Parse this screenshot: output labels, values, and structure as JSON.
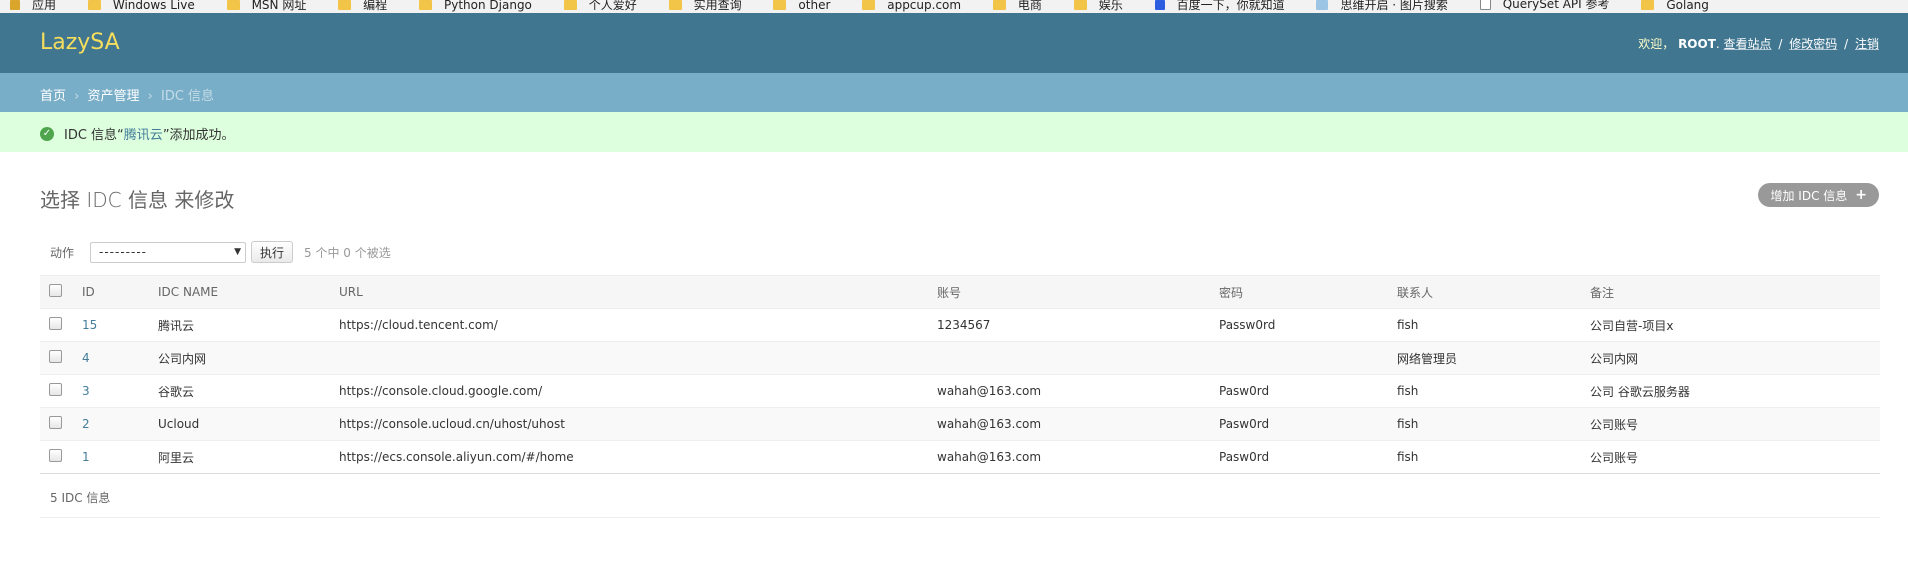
{
  "bookmarks": [
    {
      "label": "应用",
      "icon": "apps-icon"
    },
    {
      "label": "Windows Live",
      "icon": "folder-icon"
    },
    {
      "label": "MSN 网址",
      "icon": "folder-icon"
    },
    {
      "label": "编程",
      "icon": "folder-icon"
    },
    {
      "label": "Python Django",
      "icon": "folder-icon"
    },
    {
      "label": "个人爱好",
      "icon": "folder-icon"
    },
    {
      "label": "实用查询",
      "icon": "folder-icon"
    },
    {
      "label": "other",
      "icon": "folder-icon"
    },
    {
      "label": "appcup.com",
      "icon": "folder-icon"
    },
    {
      "label": "电商",
      "icon": "folder-icon"
    },
    {
      "label": "娱乐",
      "icon": "folder-icon"
    },
    {
      "label": "百度一下，你就知道",
      "icon": "baidu-icon"
    },
    {
      "label": "思维开启 · 图片搜索",
      "icon": "cloud-icon"
    },
    {
      "label": "QuerySet API 参考",
      "icon": "page-icon"
    },
    {
      "label": "Golang",
      "icon": "folder-icon"
    }
  ],
  "header": {
    "brand": "LazySA",
    "welcome": "欢迎，",
    "username": "ROOT",
    "period": ".",
    "view_site": "查看站点",
    "change_password": "修改密码",
    "logout": "注销",
    "separator": "/"
  },
  "breadcrumbs": {
    "home": "首页",
    "app": "资产管理",
    "current": "IDC 信息",
    "arrow": "›"
  },
  "message": {
    "prefix": "IDC 信息“",
    "object": "腾讯云",
    "suffix": "”添加成功。",
    "icon": "success-check-icon"
  },
  "page": {
    "title": "选择 IDC 信息 来修改",
    "add_button": "增加 IDC 信息",
    "add_icon": "+"
  },
  "actions": {
    "label": "动作",
    "selected": "---------",
    "go": "执行",
    "counter": "5 个中 0 个被选"
  },
  "table": {
    "columns": [
      "ID",
      "IDC NAME",
      "URL",
      "账号",
      "密码",
      "联系人",
      "备注"
    ],
    "rows": [
      {
        "id": "15",
        "name": "腾讯云",
        "url": "https://cloud.tencent.com/",
        "account": "1234567",
        "password": "Passw0rd",
        "contact": "fish",
        "note": "公司自营-项目x"
      },
      {
        "id": "4",
        "name": "公司内网",
        "url": "",
        "account": "",
        "password": "",
        "contact": "网络管理员",
        "note": "公司内网"
      },
      {
        "id": "3",
        "name": "谷歌云",
        "url": "https://console.cloud.google.com/",
        "account": "wahah@163.com",
        "password": "Pasw0rd",
        "contact": "fish",
        "note": "公司 谷歌云服务器"
      },
      {
        "id": "2",
        "name": "Ucloud",
        "url": "https://console.ucloud.cn/uhost/uhost",
        "account": "wahah@163.com",
        "password": "Pasw0rd",
        "contact": "fish",
        "note": "公司账号"
      },
      {
        "id": "1",
        "name": "阿里云",
        "url": "https://ecs.console.aliyun.com/#/home",
        "account": "wahah@163.com",
        "password": "Pasw0rd",
        "contact": "fish",
        "note": "公司账号"
      }
    ]
  },
  "paginator": {
    "count": "5 IDC 信息"
  },
  "colors": {
    "header": "#417690",
    "breadcrumbs": "#79aec8",
    "brand": "#f5dd5d",
    "success_bg": "#ddffdd",
    "link": "#447e9b"
  }
}
